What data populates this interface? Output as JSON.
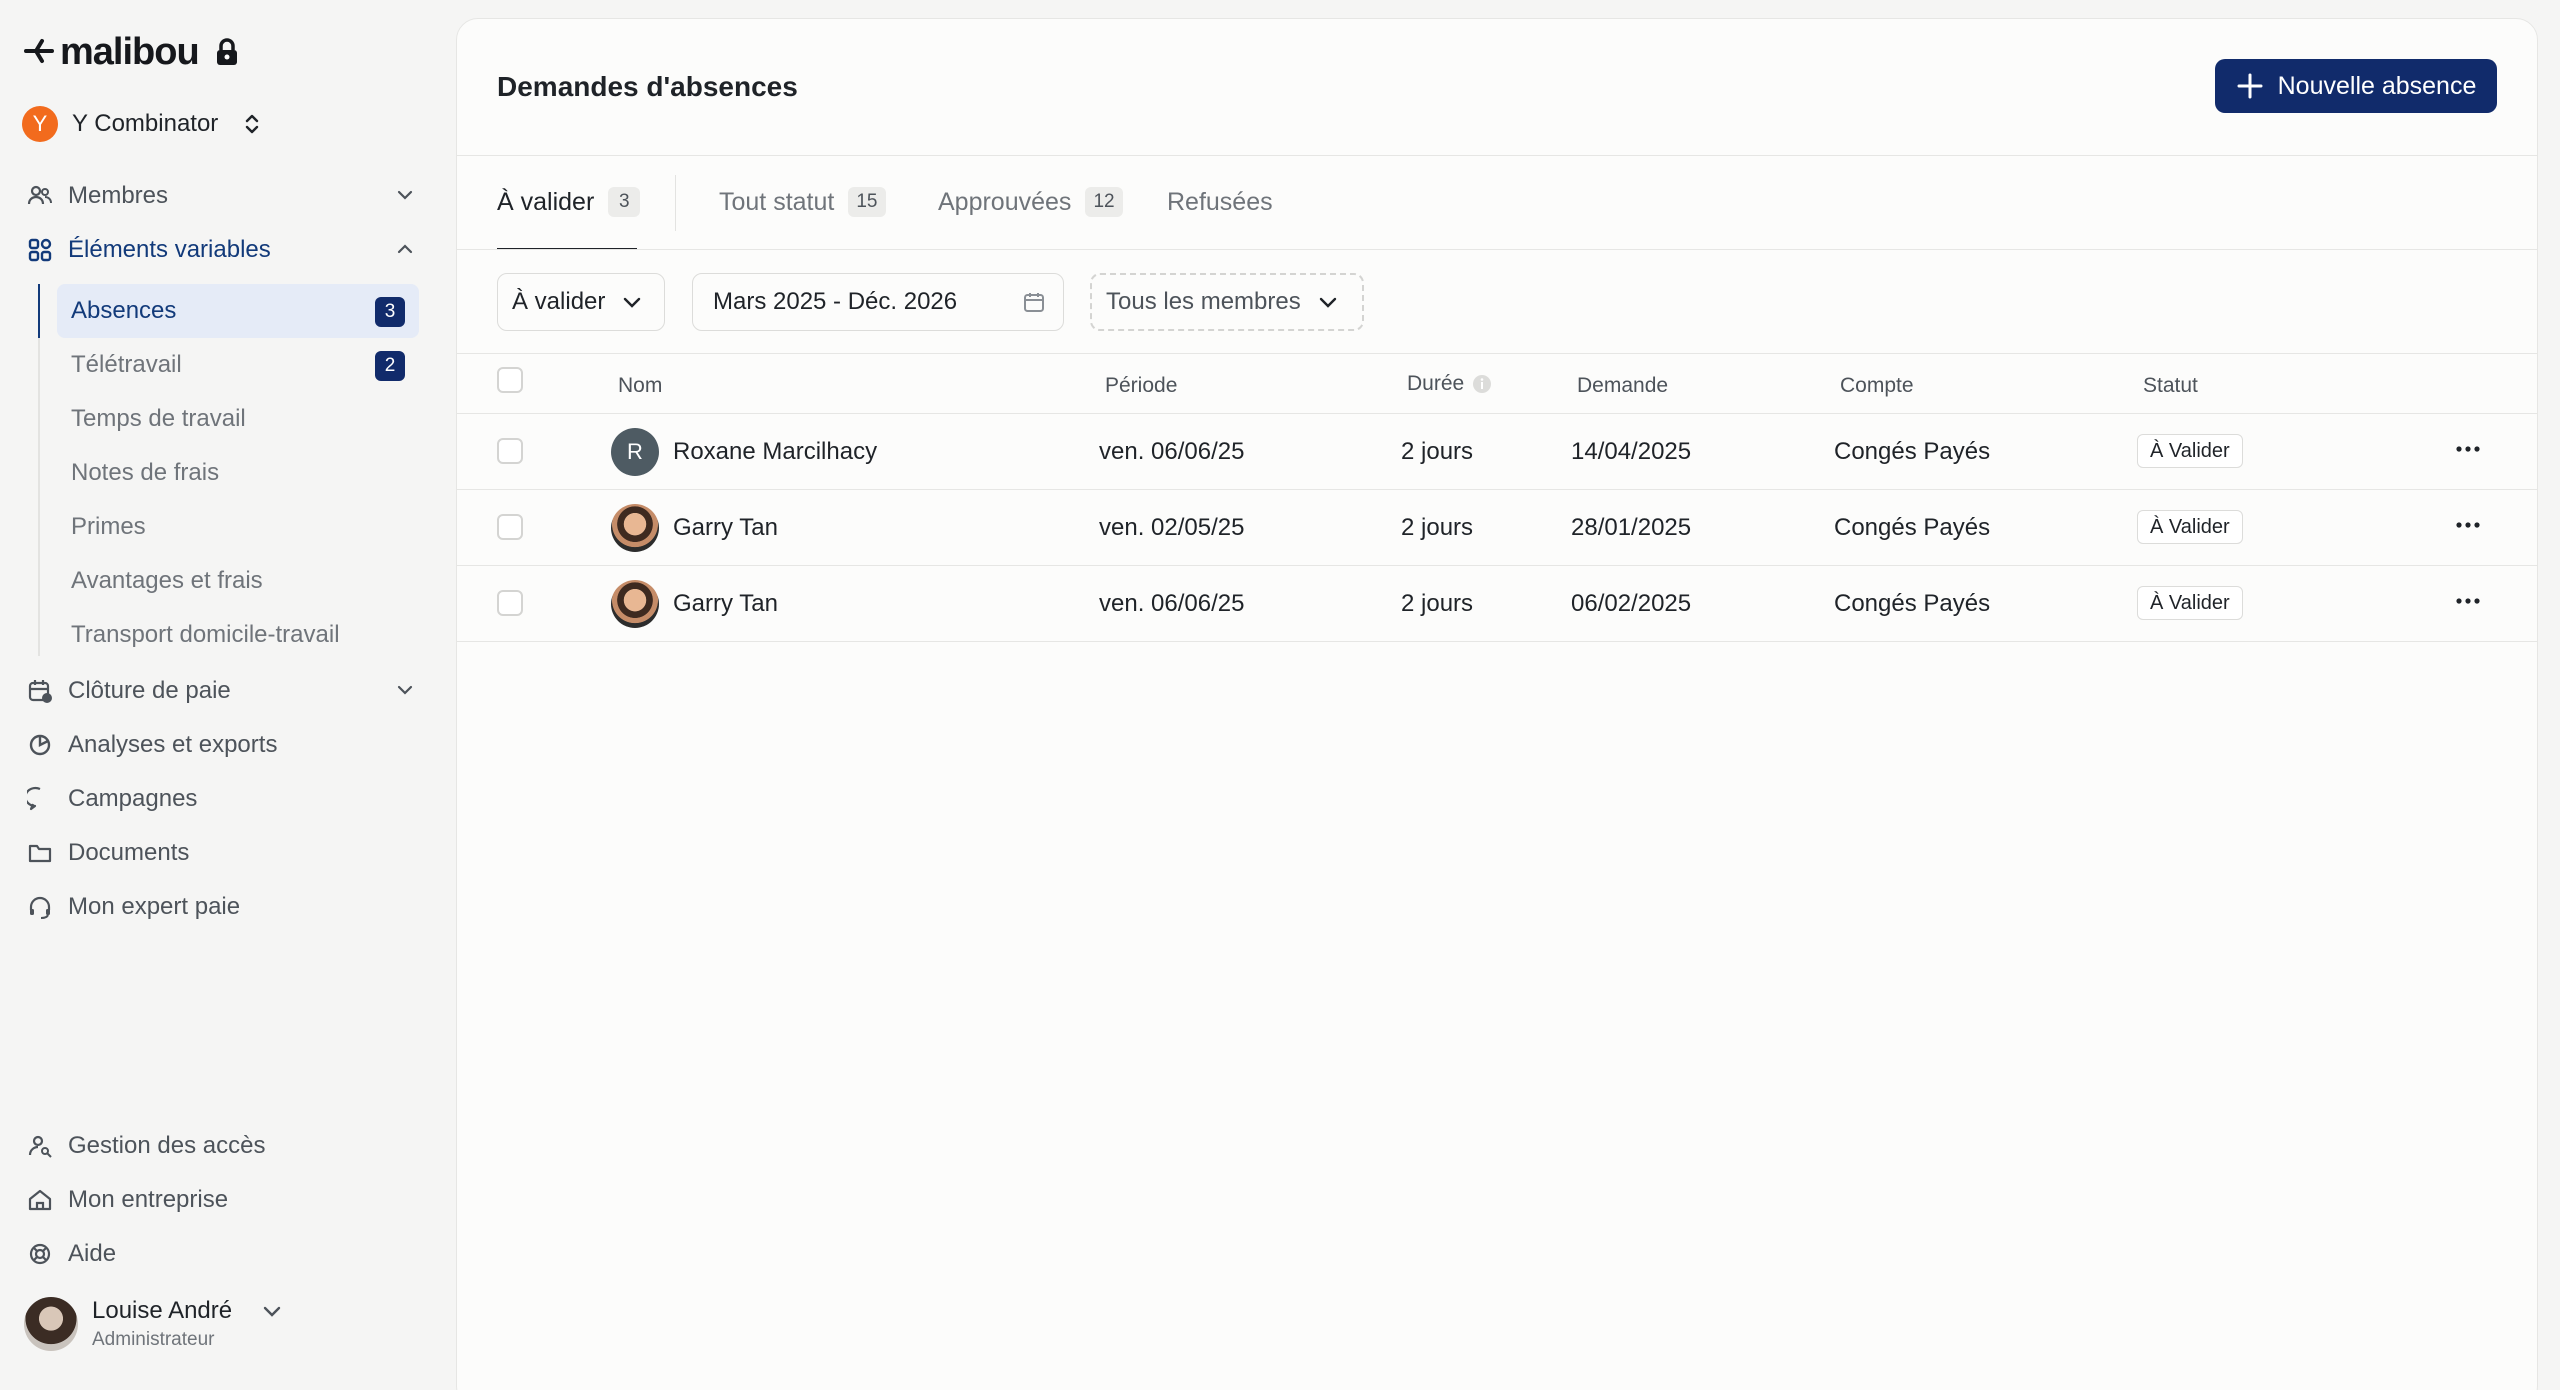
{
  "brand": {
    "name": "malibou"
  },
  "company": {
    "initial": "Y",
    "name": "Y Combinator"
  },
  "sidebar": {
    "items": [
      {
        "label": "Membres"
      },
      {
        "label": "Éléments variables"
      },
      {
        "label": "Clôture de paie"
      },
      {
        "label": "Analyses et exports"
      },
      {
        "label": "Campagnes"
      },
      {
        "label": "Documents"
      },
      {
        "label": "Mon expert paie"
      }
    ],
    "subitems": [
      {
        "label": "Absences",
        "count": "3"
      },
      {
        "label": "Télétravail",
        "count": "2"
      },
      {
        "label": "Temps de travail"
      },
      {
        "label": "Notes de frais"
      },
      {
        "label": "Primes"
      },
      {
        "label": "Avantages et frais"
      },
      {
        "label": "Transport domicile-travail"
      }
    ],
    "bottom": [
      {
        "label": "Gestion des accès"
      },
      {
        "label": "Mon entreprise"
      },
      {
        "label": "Aide"
      }
    ]
  },
  "user": {
    "name": "Louise André",
    "role": "Administrateur"
  },
  "page": {
    "title": "Demandes d'absences",
    "new_button": "Nouvelle absence"
  },
  "tabs": [
    {
      "label": "À valider",
      "count": "3"
    },
    {
      "label": "Tout statut",
      "count": "15"
    },
    {
      "label": "Approuvées",
      "count": "12"
    },
    {
      "label": "Refusées"
    }
  ],
  "filters": {
    "status": "À valider",
    "date_range": "Mars 2025 - Déc. 2026",
    "members": "Tous les membres"
  },
  "table": {
    "headers": {
      "name": "Nom",
      "period": "Période",
      "duration": "Durée",
      "request": "Demande",
      "account": "Compte",
      "status": "Statut"
    },
    "rows": [
      {
        "initial": "R",
        "name": "Roxane Marcilhacy",
        "period": "ven. 06/06/25",
        "duration": "2 jours",
        "request": "14/04/2025",
        "account": "Congés Payés",
        "status": "À Valider"
      },
      {
        "initial": "",
        "name": "Garry Tan",
        "period": "ven. 02/05/25",
        "duration": "2 jours",
        "request": "28/01/2025",
        "account": "Congés Payés",
        "status": "À Valider"
      },
      {
        "initial": "",
        "name": "Garry Tan",
        "period": "ven. 06/06/25",
        "duration": "2 jours",
        "request": "06/02/2025",
        "account": "Congés Payés",
        "status": "À Valider"
      }
    ]
  },
  "colors": {
    "accent": "#112b6b",
    "company_badge": "#f26b1d",
    "active_nav": "#123a7a"
  }
}
